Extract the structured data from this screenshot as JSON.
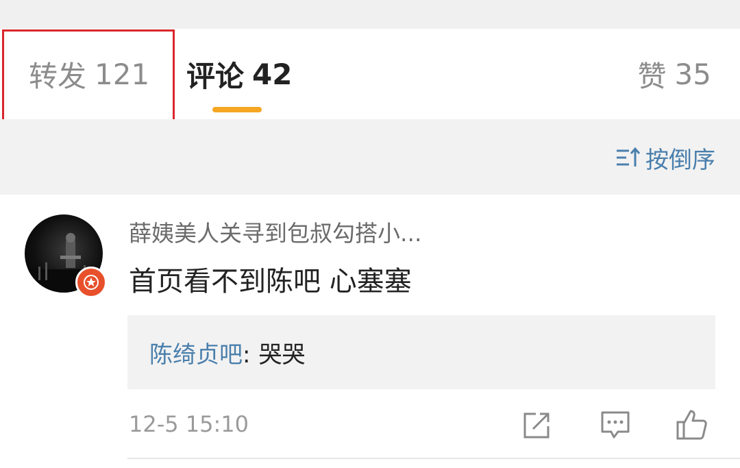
{
  "tabs": {
    "reposts": {
      "label": "转发",
      "count": "121"
    },
    "comments": {
      "label": "评论",
      "count": "42"
    },
    "likes": {
      "label": "赞",
      "count": "35"
    }
  },
  "colors": {
    "accent": "#f5a623",
    "highlight_box": "#d9262c",
    "link": "#4a7fac",
    "badge": "#e8502b"
  },
  "sort": {
    "label": "按倒序",
    "icon": "sort-icon"
  },
  "comment": {
    "username": "薛姨美人关寻到包叔勾搭小...",
    "text": "首页看不到陈吧 心塞塞",
    "reply": {
      "author": "陈绮贞吧",
      "separator": ":",
      "text": "哭哭"
    },
    "timestamp": "12-5 15:10",
    "actions": [
      "share-icon",
      "reply-icon",
      "like-icon"
    ]
  }
}
